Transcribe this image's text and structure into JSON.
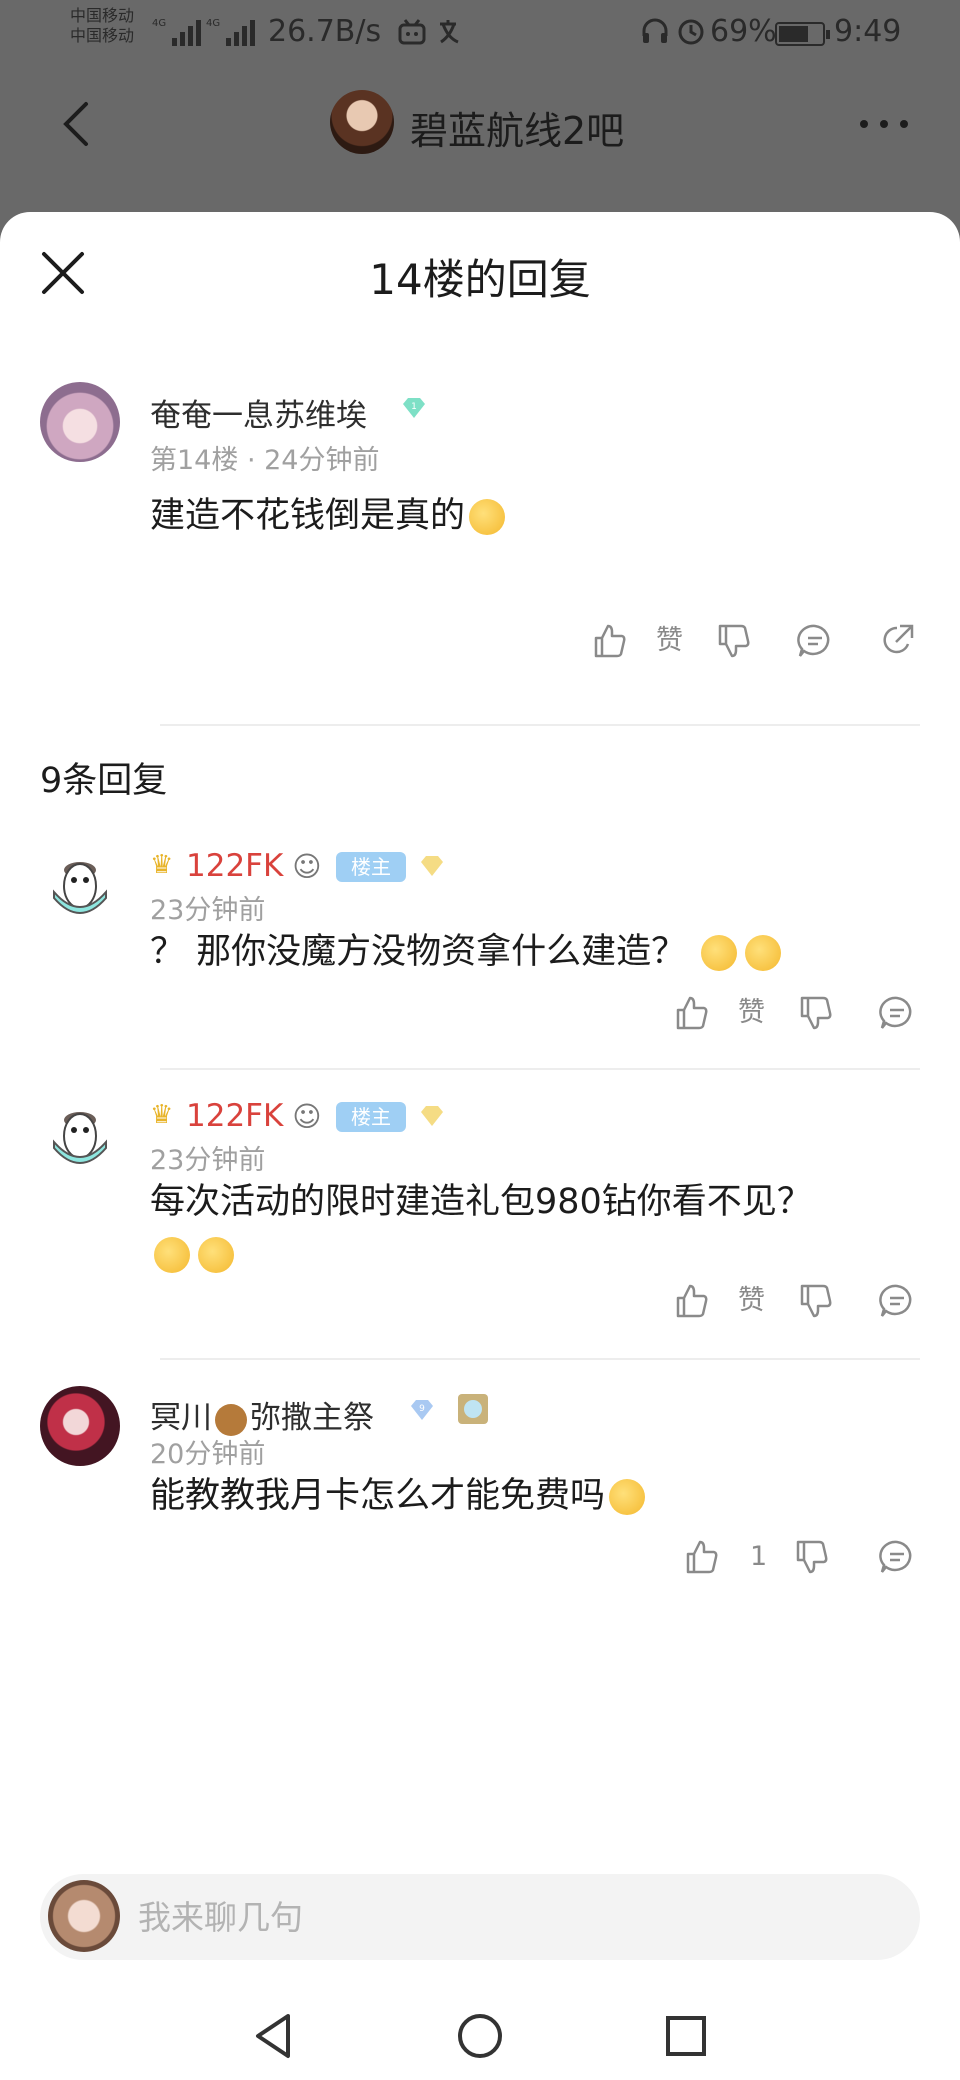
{
  "status_bar": {
    "carrier_1": "中国移动",
    "carrier_2": "中国移动",
    "net_1": "4G",
    "net_2": "4G",
    "speed": "26.7B/s",
    "battery": "69%",
    "battery_level": 0.69,
    "time": "9:49"
  },
  "top_bar": {
    "forum_name": "碧蓝航线2吧"
  },
  "sheet": {
    "title": "14楼的回复"
  },
  "main_post": {
    "author": "奄奄一息苏维埃",
    "level": "1",
    "floor": "第14楼",
    "time": "24分钟前",
    "text": "建造不花钱倒是真的",
    "like_label": "赞"
  },
  "replies_header": "9条回复",
  "replies": [
    {
      "author": "122FK",
      "badge": "楼主",
      "time": "23分钟前",
      "text": "？ 那你没魔方没物资拿什么建造？",
      "like_label": "赞"
    },
    {
      "author": "122FK",
      "badge": "楼主",
      "time": "23分钟前",
      "text": "每次活动的限时建造礼包980钻你看不见？",
      "like_label": "赞"
    },
    {
      "author_a": "冥川",
      "author_b": "弥撒主祭",
      "level": "9",
      "time": "20分钟前",
      "text": "能教教我月卡怎么才能免费吗",
      "like_count": "1"
    }
  ],
  "composer": {
    "placeholder": "我来聊几句"
  },
  "colors": {
    "dim_overlay": "#696969",
    "author_red": "#d9423c",
    "badge_blue": "#9fcff4",
    "meta_gray": "#a0a0a0"
  }
}
